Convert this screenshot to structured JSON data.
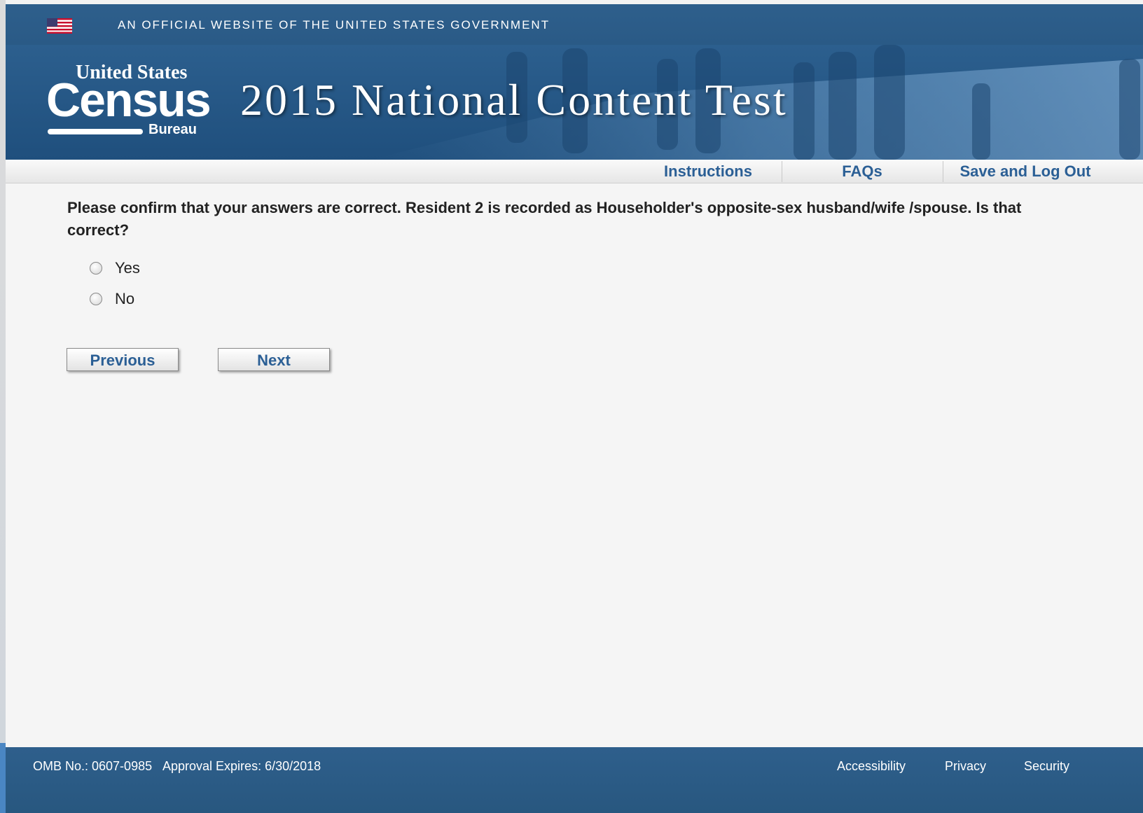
{
  "gov_banner": {
    "text": "AN OFFICIAL WEBSITE OF THE UNITED STATES GOVERNMENT"
  },
  "header": {
    "logo": {
      "line1": "United States",
      "line2": "Census",
      "line3": "Bureau"
    },
    "title": "2015 National Content Test"
  },
  "nav": {
    "items": [
      {
        "label": "Instructions"
      },
      {
        "label": "FAQs"
      },
      {
        "label": "Save and Log Out"
      }
    ]
  },
  "question": {
    "text": "Please confirm that your answers are correct. Resident 2 is recorded as Householder's opposite-sex husband/wife /spouse. Is that correct?",
    "options": [
      {
        "label": "Yes",
        "selected": false
      },
      {
        "label": "No",
        "selected": false
      }
    ]
  },
  "buttons": {
    "previous": "Previous",
    "next": "Next"
  },
  "footer": {
    "omb": "OMB No.: 0607-0985",
    "approval": "Approval Expires: 6/30/2018",
    "links": [
      {
        "label": "Accessibility"
      },
      {
        "label": "Privacy"
      },
      {
        "label": "Security"
      }
    ]
  },
  "colors": {
    "banner_blue": "#2e5f8c",
    "link_blue": "#2b5f95",
    "page_bg": "#f5f5f5"
  }
}
